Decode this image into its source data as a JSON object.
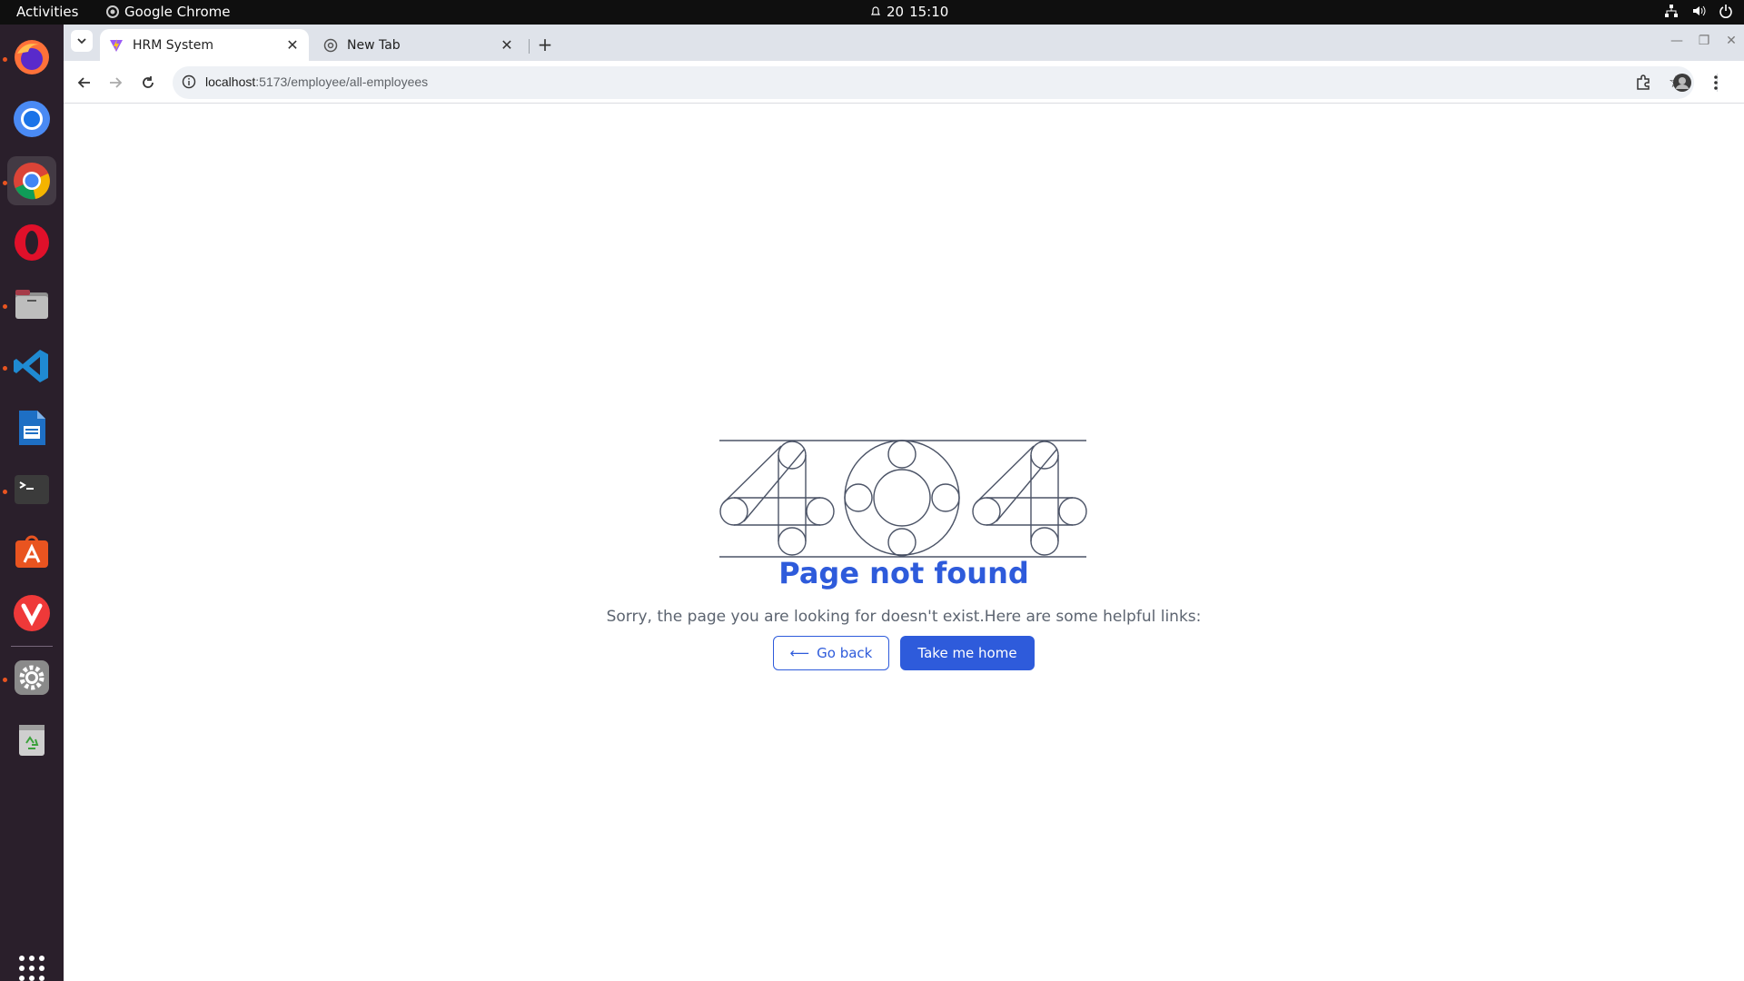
{
  "topbar": {
    "activities": "Activities",
    "app_name": "Google Chrome",
    "clock_day": "20",
    "clock_time": "15:10"
  },
  "dock": {
    "items": [
      "firefox-icon",
      "chromium-icon",
      "chrome-icon",
      "opera-icon",
      "files-icon",
      "vscode-icon",
      "writer-icon",
      "terminal-icon",
      "app-center-icon",
      "vivaldi-icon",
      "settings-icon",
      "trash-icon",
      "show-apps-icon"
    ]
  },
  "browser": {
    "tabs": [
      {
        "title": "HRM System",
        "active": true
      },
      {
        "title": "New Tab",
        "active": false
      }
    ],
    "url_host": "localhost",
    "url_path": ":5173/employee/all-employees"
  },
  "page": {
    "title": "Page not found",
    "message": "Sorry, the page you are looking for doesn't exist.Here are some helpful links:",
    "back_label": "Go back",
    "back_arrow": "⟵",
    "home_label": "Take me home",
    "accent_color": "#2e5bdb"
  }
}
